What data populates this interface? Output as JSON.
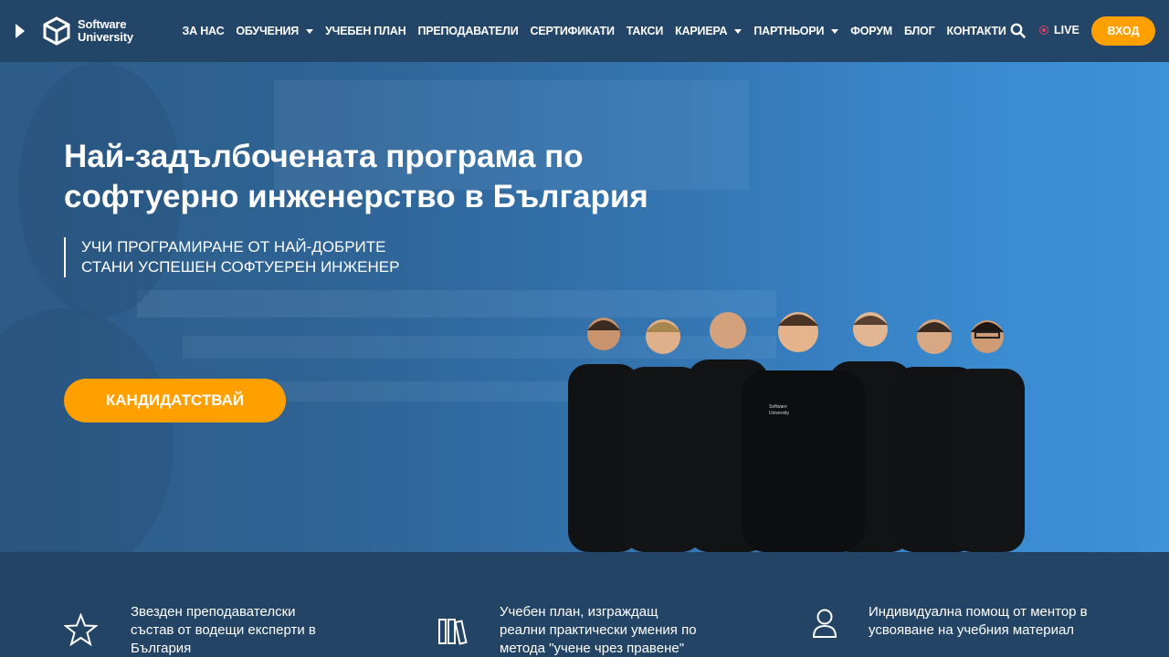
{
  "brand": {
    "line1": "Software",
    "line2": "University"
  },
  "nav": {
    "items": [
      {
        "label": "ЗА НАС",
        "dropdown": false
      },
      {
        "label": "ОБУЧЕНИЯ",
        "dropdown": true
      },
      {
        "label": "УЧЕБЕН ПЛАН",
        "dropdown": false
      },
      {
        "label": "ПРЕПОДАВАТЕЛИ",
        "dropdown": false
      },
      {
        "label": "СЕРТИФИКАТИ",
        "dropdown": false
      },
      {
        "label": "ТАКСИ",
        "dropdown": false
      },
      {
        "label": "КАРИЕРА",
        "dropdown": true
      },
      {
        "label": "ПАРТНЬОРИ",
        "dropdown": true
      },
      {
        "label": "ФОРУМ",
        "dropdown": false
      },
      {
        "label": "БЛОГ",
        "dropdown": false
      },
      {
        "label": "КОНТАКТИ",
        "dropdown": false
      }
    ],
    "live_label": "LIVE",
    "login_label": "ВХОД"
  },
  "hero": {
    "title_line1": "Най-задълбочената програма по",
    "title_line2": "софтуерно инженерство в България",
    "sub_line1": "УЧИ ПРОГРАМИРАНЕ ОТ НАЙ-ДОБРИТЕ",
    "sub_line2": "СТАНИ УСПЕШЕН СОФТУЕРЕН ИНЖЕНЕР",
    "cta_label": "КАНДИДАТСТВАЙ",
    "shirt_logo_line1": "Software",
    "shirt_logo_line2": "University"
  },
  "features": [
    {
      "icon": "star-icon",
      "line1": "Звезден преподавателски",
      "line2": "състав от водещи експерти в",
      "line3": "България"
    },
    {
      "icon": "books-icon",
      "line1": "Учебен план, изграждащ",
      "line2": "реални практически умения по",
      "line3": "метода \"учене чрез правене\""
    },
    {
      "icon": "user-icon",
      "line1": "Индивидуална помощ от ментор в",
      "line2": "усвояване на учебния материал",
      "line3": ""
    }
  ],
  "colors": {
    "accent": "#ffa000",
    "navbar": "#234567",
    "live": "#e0426a"
  }
}
